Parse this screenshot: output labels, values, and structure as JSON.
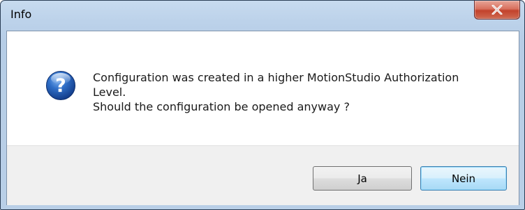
{
  "window": {
    "title": "Info",
    "close_icon": "close-icon"
  },
  "dialog": {
    "icon": "question-icon",
    "message_lines": [
      "Configuration was created in a higher MotionStudio Authorization",
      "Level.",
      "Should the configuration be opened anyway ?"
    ]
  },
  "buttons": {
    "yes_label": "Ja",
    "no_label": "Nein"
  },
  "colors": {
    "close_button": "#c7503a",
    "default_button_border": "#3c7fb1",
    "icon_blue": "#1d4fa3"
  }
}
